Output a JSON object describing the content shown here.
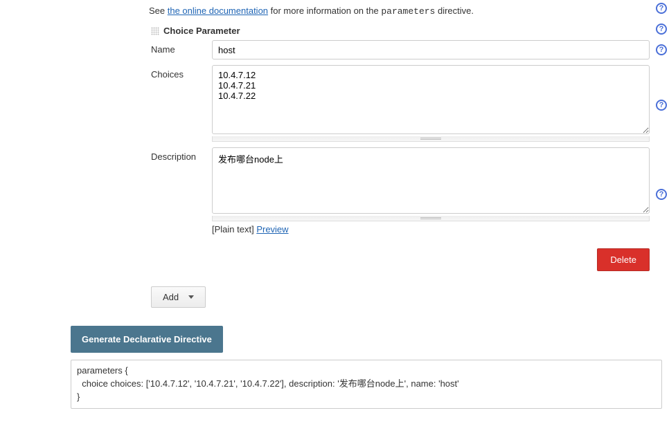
{
  "info": {
    "prefix": "See ",
    "link": "the online documentation",
    "middle": " for more information on the ",
    "code": "parameters",
    "suffix": " directive."
  },
  "param": {
    "header": "Choice Parameter",
    "name_label": "Name",
    "name_value": "host",
    "choices_label": "Choices",
    "choices_value": "10.4.7.12\n10.4.7.21\n10.4.7.22",
    "desc_label": "Description",
    "desc_value": "发布哪台node上",
    "format_plain": "[Plain text] ",
    "format_preview": "Preview"
  },
  "buttons": {
    "delete": "Delete",
    "add": "Add",
    "generate": "Generate Declarative Directive"
  },
  "output": "parameters {\n  choice choices: ['10.4.7.12', '10.4.7.21', '10.4.7.22'], description: '发布哪台node上', name: 'host'\n}"
}
